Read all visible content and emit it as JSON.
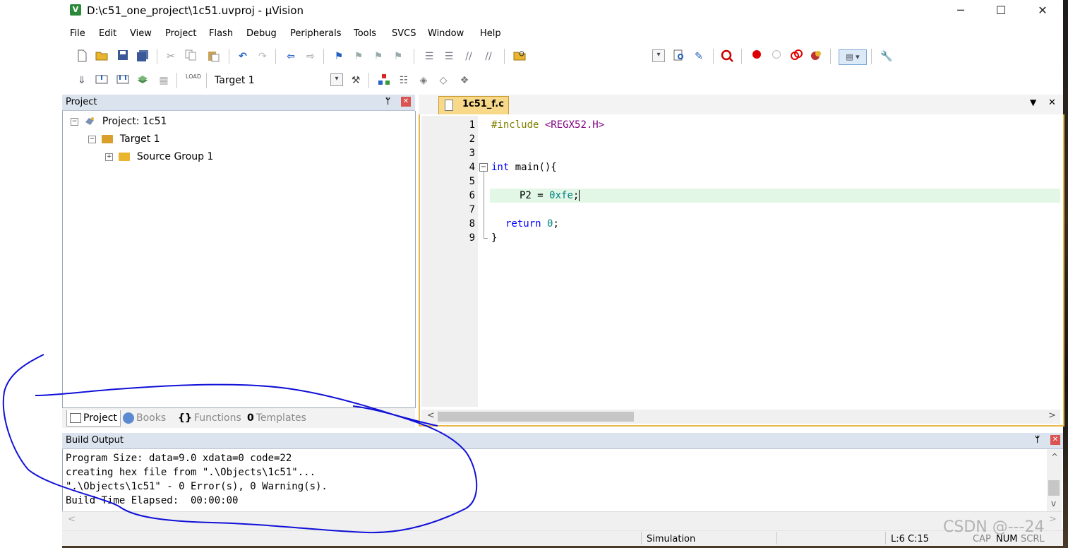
{
  "window": {
    "title": "D:\\c51_one_project\\1c51.uvproj - µVision",
    "app_icon_glyph": "V",
    "minimize_glyph": "─",
    "maximize_glyph": "☐",
    "close_glyph": "✕"
  },
  "menu": [
    "File",
    "Edit",
    "View",
    "Project",
    "Flash",
    "Debug",
    "Peripherals",
    "Tools",
    "SVCS",
    "Window",
    "Help"
  ],
  "toolbar2": {
    "target_select": "Target 1",
    "load_label": "LOAD"
  },
  "project_panel": {
    "title": "Project",
    "pin_glyph": "ᛘ",
    "close_glyph": "✕",
    "tree": {
      "root": "Project: 1c51",
      "target": "Target 1",
      "group": "Source Group 1"
    },
    "tabs": {
      "project": "Project",
      "books": "Books",
      "functions": "Functions",
      "templates": "Templates",
      "functions_glyph": "{}",
      "templates_glyph": "0"
    }
  },
  "editor": {
    "file_tab": "1c51_f.c",
    "tabrow_dropdown_glyph": "▼",
    "tabrow_close_glyph": "✕",
    "line_numbers": [
      "1",
      "2",
      "3",
      "4",
      "5",
      "6",
      "7",
      "8",
      "9"
    ],
    "lines": {
      "l1_kw": "#include",
      "l1_hdr": "<REGX52.H>",
      "l4_kw": "int",
      "l4_rest": "main(){",
      "l6_var": "P2 = ",
      "l6_val": "0xfe",
      "l6_end": ";",
      "l8_kw": "return",
      "l8_val": "0",
      "l8_end": ";",
      "l9": "}"
    },
    "fold_minus": "−",
    "hscroll_left": "<",
    "hscroll_right": ">"
  },
  "build_output": {
    "title": "Build Output",
    "lines": [
      "Program Size: data=9.0 xdata=0 code=22",
      "creating hex file from \".\\Objects\\1c51\"...",
      "\".\\Objects\\1c51\" - 0 Error(s), 0 Warning(s).",
      "Build Time Elapsed:  00:00:00"
    ],
    "scroll_up": "^",
    "scroll_down": "v",
    "scroll_left": "<",
    "scroll_right": ">"
  },
  "status_bar": {
    "mode": "Simulation",
    "position": "L:6 C:15",
    "cap": "CAP",
    "num": "NUM",
    "scrl": "SCRL"
  },
  "watermark": "CSDN @---24",
  "colors": {
    "keyword": "#0000ff",
    "preprocessor": "#808000",
    "header": "#800080",
    "number": "#008080",
    "highlight_line": "#e2f7e6",
    "tab_active": "#f8d98a",
    "panel_header": "#dbe3ee",
    "annotation": "#1010d8"
  }
}
